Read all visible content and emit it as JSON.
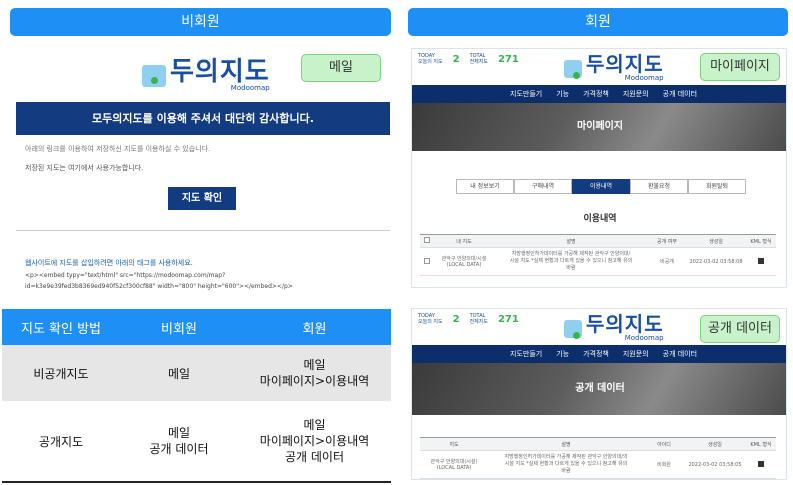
{
  "left": {
    "header": "비회원",
    "email": {
      "logo_text": "두의지도",
      "logo_sub": "Modoomap",
      "callout": "메일",
      "banner": "모두의지도를 이용해 주셔서 대단히 감사합니다.",
      "line1": "아래의 링크를 이용하여 저장하신 지도를 이용하실 수 있습니다.",
      "line2": "저장된 지도는 여기에서 사용가능합니다.",
      "button": "지도 확인",
      "embed_title": "웹사이트에 지도를 삽입하려면 아래의 태그를 사용하세요.",
      "embed_code_1": "<p><embed typy=\"text/html\" src=\"https://modoomap.com/map?",
      "embed_code_2": "id=k3e9e39fed3b8369ed940f52cf300cf88\" width=\"800\" height=\"600\"></embed></p>"
    },
    "compare": {
      "headers": [
        "지도 확인 방법",
        "비회원",
        "회원"
      ],
      "rows": [
        {
          "method": "비공개지도",
          "guest": "메일",
          "member1": "메일",
          "member2": "마이페이지>이용내역",
          "member3": ""
        },
        {
          "method": "공개지도",
          "guest": "메일",
          "guest2": "공개 데이터",
          "member1": "메일",
          "member2": "마이페이지>이용내역",
          "member3": "공개 데이터"
        }
      ]
    }
  },
  "right": {
    "header": "회원",
    "top_panel": {
      "today_label": "TODAY",
      "today_sub": "오늘의 지도",
      "today_value": "2",
      "total_label": "TOTAL",
      "total_sub": "전체지도",
      "total_value": "271",
      "logo_text": "두의지도",
      "logo_sub": "Modoomap",
      "callout": "마이페이지",
      "nav": [
        "지도만들기",
        "기능",
        "가격정책",
        "지원문의",
        "공개 데이터"
      ],
      "hero_title": "마이페이지",
      "tabs": [
        "내 정보보기",
        "구매내역",
        "이용내역",
        "환불요청",
        "회원탈퇴"
      ],
      "active_tab": 2,
      "section_title": "이용내역",
      "table_headers": [
        "",
        "내 지도",
        "설명",
        "공개 여부",
        "생성일",
        "KML 형식"
      ],
      "row": {
        "map": "관악구 안양의대/시설(LOCAL DATA)",
        "desc_1": "지방행정인허가데이터를 가공해 제작된 관악구 안양의대/",
        "desc_2": "시설 지도 *실제 현황과 다르게 있을 수 있으니 참고해 유의",
        "desc_3": "바람",
        "public": "비공개",
        "date": "2022-03-02 03:58:08"
      }
    },
    "bottom_panel": {
      "today_label": "TODAY",
      "today_sub": "오늘의 지도",
      "today_value": "2",
      "total_label": "TOTAL",
      "total_sub": "전체지도",
      "total_value": "271",
      "logo_text": "두의지도",
      "logo_sub": "Modoomap",
      "callout": "공개 데이터",
      "nav": [
        "지도만들기",
        "기능",
        "가격정책",
        "지원문의",
        "공개 데이터"
      ],
      "hero_title": "공개 데이터",
      "table_headers": [
        "지도",
        "설명",
        "아이디",
        "생성일",
        "KML 형식"
      ],
      "row": {
        "map": "관악구 안양의대(시설)(LOCAL DATA)",
        "desc_1": "지방행정인허가데이터를 가공해 제작된 관악구 안양의대/의",
        "desc_2": "시설 지도 *실제 현황과 다르게 있을 수 있으니 참고해 유의",
        "desc_3": "바람",
        "user": "비회원",
        "date": "2022-03-02 03:58:05"
      }
    }
  },
  "colors": {
    "accent": "#1e90f5",
    "navy": "#123b80",
    "green": "#c8f2c9"
  }
}
